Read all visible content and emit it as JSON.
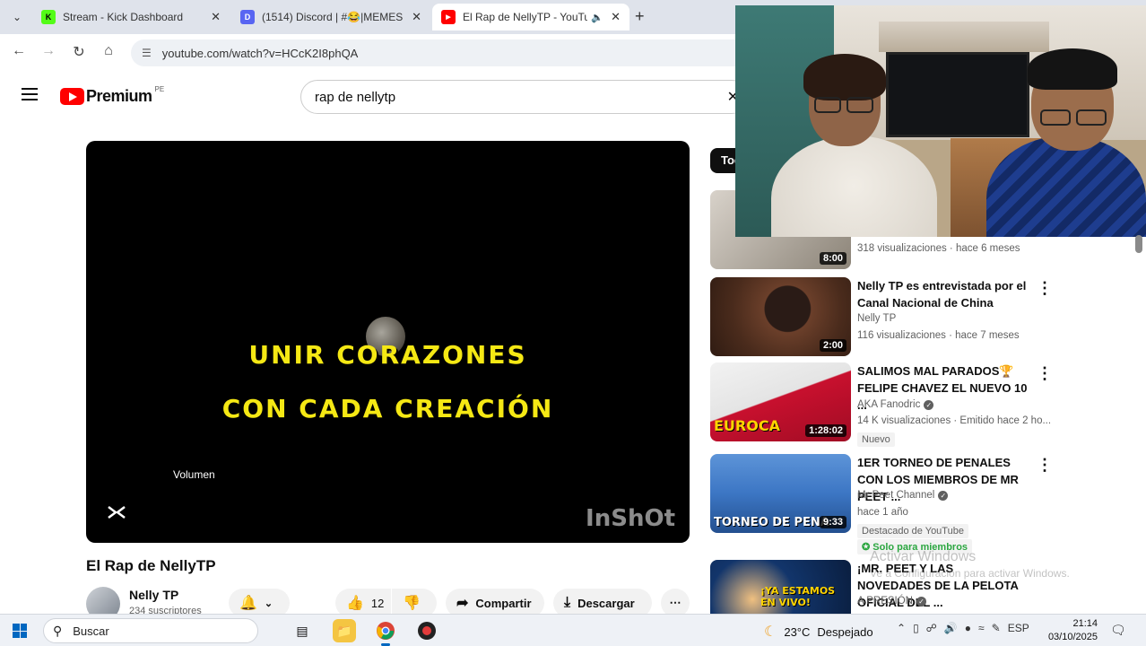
{
  "browser": {
    "tabs": [
      {
        "title": "Stream - Kick Dashboard",
        "favicon_color": "#53fc18",
        "favicon_glyph": "K",
        "active": false
      },
      {
        "title": "(1514) Discord | #😂|MEMES |",
        "favicon_color": "#5865f2",
        "favicon_glyph": "D",
        "active": false
      },
      {
        "title": "El Rap de NellyTP - YouTube",
        "favicon_color": "#ff0000",
        "favicon_glyph": "▶",
        "active": true
      }
    ],
    "new_tab_icon": "plus-icon",
    "url": "youtube.com/watch?v=HCcK2I8phQA"
  },
  "youtube": {
    "logo_text": "Premium",
    "logo_country": "PE",
    "search_query": "rap de nellytp",
    "player": {
      "lyric_line_1": "UNIR CORAZONES",
      "lyric_line_2": "CON CADA CREACIÓN",
      "volume_label": "Volumen",
      "watermark": "InShOt"
    },
    "video": {
      "title": "El Rap de NellyTP",
      "channel_name": "Nelly TP",
      "subscribers": "234 suscriptores",
      "likes": "12",
      "share_label": "Compartir",
      "download_label": "Descargar"
    },
    "sidebar": {
      "chip_label": "Todos",
      "items": [
        {
          "title": "",
          "channel": "",
          "meta": "318 visualizaciones · hace 6 meses",
          "duration": "8:00",
          "caption": "",
          "thumb_color": "#c7c1ba",
          "badges": []
        },
        {
          "title": "Nelly TP es entrevistada por el Canal Nacional de China",
          "channel": "Nelly TP",
          "verified": false,
          "meta": "116 visualizaciones · hace 7 meses",
          "duration": "2:00",
          "caption": "",
          "thumb_color": "#6b3f2a",
          "badges": []
        },
        {
          "title": "SALIMOS MAL PARADOS🏆 FELIPE CHAVEZ EL NUEVO 10 ...",
          "channel": "AKA Fanodric",
          "verified": true,
          "meta": "14 K visualizaciones · Emitido hace 2 ho...",
          "duration": "1:28:02",
          "caption": "EUROCA",
          "thumb_color": "#c8102e",
          "badges": [
            "Nuevo"
          ]
        },
        {
          "title": "1ER TORNEO DE PENALES CON LOS MIEMBROS DE MR PEET ...",
          "channel": "Mr Peet Channel",
          "verified": true,
          "meta": "hace 1 año",
          "duration": "9:33",
          "caption": "TORNEO DE PENA",
          "thumb_color": "#3c76c4",
          "badges": [
            "Destacado de YouTube",
            "Solo para miembros"
          ]
        },
        {
          "title": "¡MR. PEET Y LAS NOVEDADES DE LA PELOTA OFICIAL DEL ...",
          "channel": "A PRESIÓN",
          "verified": true,
          "meta": "",
          "duration": "",
          "caption": "¡YA ESTAMOS EN VIVO!",
          "thumb_color": "#12356b",
          "badges": []
        }
      ]
    }
  },
  "activate_windows": {
    "line1": "Activar Windows",
    "line2": "Ve a Configuración para activar Windows."
  },
  "taskbar": {
    "search_placeholder": "Buscar",
    "weather_temp": "23°C",
    "weather_desc": "Despejado",
    "language": "ESP",
    "time": "21:14",
    "date": "03/10/2025"
  }
}
